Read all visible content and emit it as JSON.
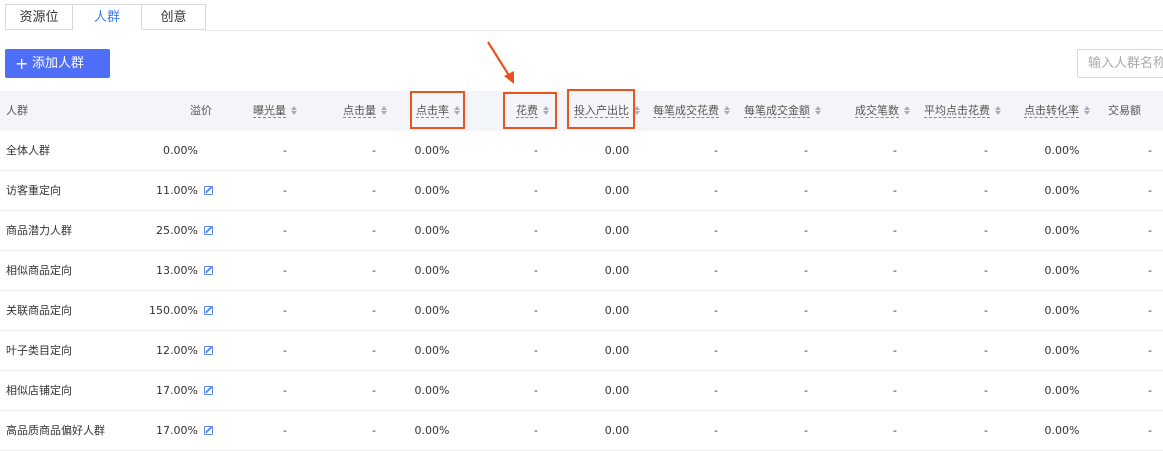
{
  "tabs": [
    {
      "label": "资源位",
      "active": false
    },
    {
      "label": "人群",
      "active": true
    },
    {
      "label": "创意",
      "active": false
    }
  ],
  "toolbar": {
    "add_label": "添加人群",
    "add_icon": "plus-icon",
    "search_placeholder": "输入人群名称"
  },
  "columns": {
    "name": "人群",
    "premium": "溢价",
    "impressions": "曝光量",
    "clicks": "点击量",
    "ctr": "点击率",
    "spend": "花费",
    "roi": "投入产出比",
    "cost_per_order": "每笔成交花费",
    "amount_per_order": "每笔成交金额",
    "orders": "成交笔数",
    "avg_cpc": "平均点击花费",
    "cvr": "点击转化率",
    "gmv": "交易额"
  },
  "rows": [
    {
      "name": "全体人群",
      "premium": "0.00%",
      "editable": false,
      "impressions": "-",
      "clicks": "-",
      "ctr": "0.00%",
      "spend": "-",
      "roi": "0.00",
      "cost_per_order": "-",
      "amount_per_order": "-",
      "orders": "-",
      "avg_cpc": "-",
      "cvr": "0.00%",
      "gmv": "-"
    },
    {
      "name": "访客重定向",
      "premium": "11.00%",
      "editable": true,
      "impressions": "-",
      "clicks": "-",
      "ctr": "0.00%",
      "spend": "-",
      "roi": "0.00",
      "cost_per_order": "-",
      "amount_per_order": "-",
      "orders": "-",
      "avg_cpc": "-",
      "cvr": "0.00%",
      "gmv": "-"
    },
    {
      "name": "商品潜力人群",
      "premium": "25.00%",
      "editable": true,
      "impressions": "-",
      "clicks": "-",
      "ctr": "0.00%",
      "spend": "-",
      "roi": "0.00",
      "cost_per_order": "-",
      "amount_per_order": "-",
      "orders": "-",
      "avg_cpc": "-",
      "cvr": "0.00%",
      "gmv": "-"
    },
    {
      "name": "相似商品定向",
      "premium": "13.00%",
      "editable": true,
      "impressions": "-",
      "clicks": "-",
      "ctr": "0.00%",
      "spend": "-",
      "roi": "0.00",
      "cost_per_order": "-",
      "amount_per_order": "-",
      "orders": "-",
      "avg_cpc": "-",
      "cvr": "0.00%",
      "gmv": "-"
    },
    {
      "name": "关联商品定向",
      "premium": "150.00%",
      "editable": true,
      "impressions": "-",
      "clicks": "-",
      "ctr": "0.00%",
      "spend": "-",
      "roi": "0.00",
      "cost_per_order": "-",
      "amount_per_order": "-",
      "orders": "-",
      "avg_cpc": "-",
      "cvr": "0.00%",
      "gmv": "-"
    },
    {
      "name": "叶子类目定向",
      "premium": "12.00%",
      "editable": true,
      "impressions": "-",
      "clicks": "-",
      "ctr": "0.00%",
      "spend": "-",
      "roi": "0.00",
      "cost_per_order": "-",
      "amount_per_order": "-",
      "orders": "-",
      "avg_cpc": "-",
      "cvr": "0.00%",
      "gmv": "-"
    },
    {
      "name": "相似店铺定向",
      "premium": "17.00%",
      "editable": true,
      "impressions": "-",
      "clicks": "-",
      "ctr": "0.00%",
      "spend": "-",
      "roi": "0.00",
      "cost_per_order": "-",
      "amount_per_order": "-",
      "orders": "-",
      "avg_cpc": "-",
      "cvr": "0.00%",
      "gmv": "-"
    },
    {
      "name": "高品质商品偏好人群",
      "premium": "17.00%",
      "editable": true,
      "impressions": "-",
      "clicks": "-",
      "ctr": "0.00%",
      "spend": "-",
      "roi": "0.00",
      "cost_per_order": "-",
      "amount_per_order": "-",
      "orders": "-",
      "avg_cpc": "-",
      "cvr": "0.00%",
      "gmv": "-"
    }
  ],
  "colors": {
    "accent": "#4f6ef7",
    "highlight": "#e8531f",
    "header_bg": "#f4f5f8"
  }
}
